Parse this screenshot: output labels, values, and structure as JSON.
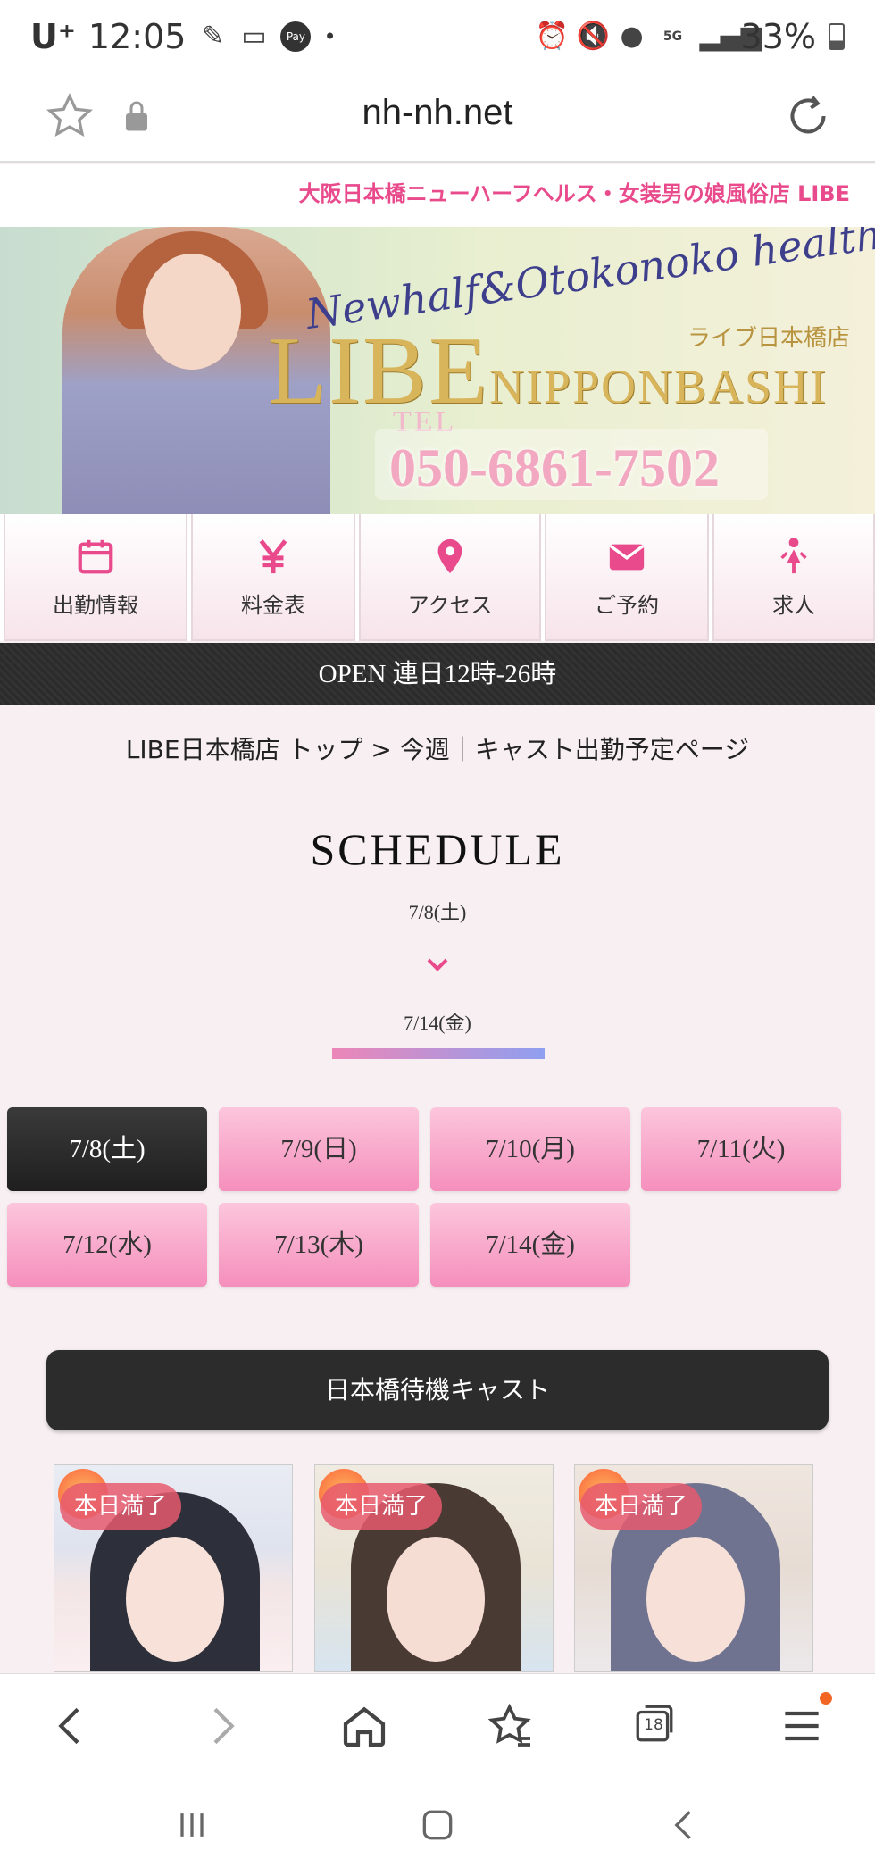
{
  "status": {
    "carrier": "U⁺",
    "time": "12:05",
    "pay_label": "Pay",
    "dot": "•",
    "battery": "33%"
  },
  "browser": {
    "url": "nh-nh.net",
    "tab_count": "18"
  },
  "site": {
    "tagline": "大阪日本橋ニューハーフヘルス・女装男の娘風俗店 LIBE",
    "hero": {
      "script": "Newhalf&Otokonoko health",
      "logo_main": "LIBE",
      "logo_sub": "NIPPONBASHI",
      "store_jp": "ライブ日本橋店",
      "tel_label": "TEL",
      "tel_number": "050-6861-7502"
    },
    "menu": [
      {
        "label": "出勤情報",
        "icon": "calendar-icon"
      },
      {
        "label": "料金表",
        "icon": "yen-icon"
      },
      {
        "label": "アクセス",
        "icon": "map-pin-icon"
      },
      {
        "label": "ご予約",
        "icon": "envelope-icon"
      },
      {
        "label": "求人",
        "icon": "person-icon"
      }
    ],
    "open_text": "OPEN 連日12時-26時",
    "breadcrumb": "LIBE日本橋店 トップ > 今週｜キャスト出勤予定ページ",
    "schedule": {
      "title": "SCHEDULE",
      "from": "7/8(土)",
      "to": "7/14(金)",
      "days": [
        "7/8(土)",
        "7/9(日)",
        "7/10(月)",
        "7/11(火)",
        "7/12(水)",
        "7/13(木)",
        "7/14(金)"
      ],
      "active_index": 0
    },
    "cast_button": "日本橋待機キャスト",
    "cast_cards": [
      {
        "badge": "本日満了"
      },
      {
        "badge": "本日満了"
      },
      {
        "badge": "本日満了"
      }
    ]
  },
  "colors": {
    "accent_pink": "#e84a8c",
    "day_pink": "#f58fbc",
    "dark": "#2b2b2b",
    "gradient_start": "#ec86b8",
    "gradient_end": "#8f9ff0"
  }
}
